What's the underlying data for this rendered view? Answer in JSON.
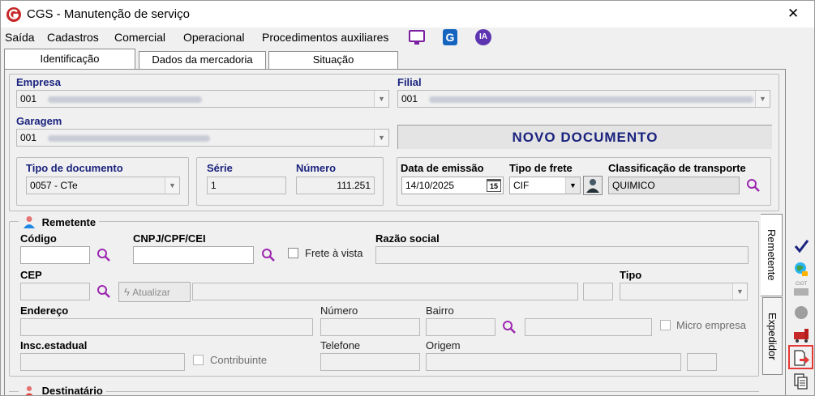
{
  "window": {
    "title": "CGS - Manutenção de serviço",
    "close_label": "✕"
  },
  "menu": {
    "items": [
      "Saída",
      "Cadastros",
      "Comercial",
      "Operacional",
      "Procedimentos auxiliares"
    ],
    "ia_label": "IA",
    "g_label": "G"
  },
  "tabs": [
    "Identificação",
    "Dados da mercadoria",
    "Situação"
  ],
  "empresa": {
    "label": "Empresa",
    "value": "001"
  },
  "filial": {
    "label": "Filial",
    "value": "001"
  },
  "garagem": {
    "label": "Garagem",
    "value": "001"
  },
  "status": {
    "text": "NOVO DOCUMENTO"
  },
  "tipo_documento": {
    "label": "Tipo de documento",
    "value": "0057 - CTe"
  },
  "serie": {
    "label": "Série",
    "value": "1"
  },
  "numero": {
    "label": "Número",
    "value": "111.251"
  },
  "data_emissao": {
    "label": "Data de emissão",
    "value": "14/10/2025",
    "calendar_label": "15"
  },
  "tipo_frete": {
    "label": "Tipo de frete",
    "value": "CIF"
  },
  "classificacao": {
    "label": "Classificação de transporte",
    "value": "QUIMICO"
  },
  "remetente": {
    "title": "Remetente",
    "codigo_label": "Código",
    "cnpj_label": "CNPJ/CPF/CEI",
    "frete_vista_label": "Frete à vista",
    "razao_social_label": "Razão social",
    "cep_label": "CEP",
    "atualizar_label": "Atualizar",
    "tipo_label": "Tipo",
    "endereco_label": "Endereço",
    "numero_label": "Número",
    "bairro_label": "Bairro",
    "micro_empresa_label": "Micro empresa",
    "insc_estadual_label": "Insc.estadual",
    "contribuinte_label": "Contribuinte",
    "telefone_label": "Telefone",
    "origem_label": "Origem"
  },
  "side_tabs": [
    "Remetente",
    "Expedidor"
  ],
  "destinatario": {
    "title": "Destinatário"
  },
  "side_toolbar": {
    "ciot_label": "CIOT"
  }
}
